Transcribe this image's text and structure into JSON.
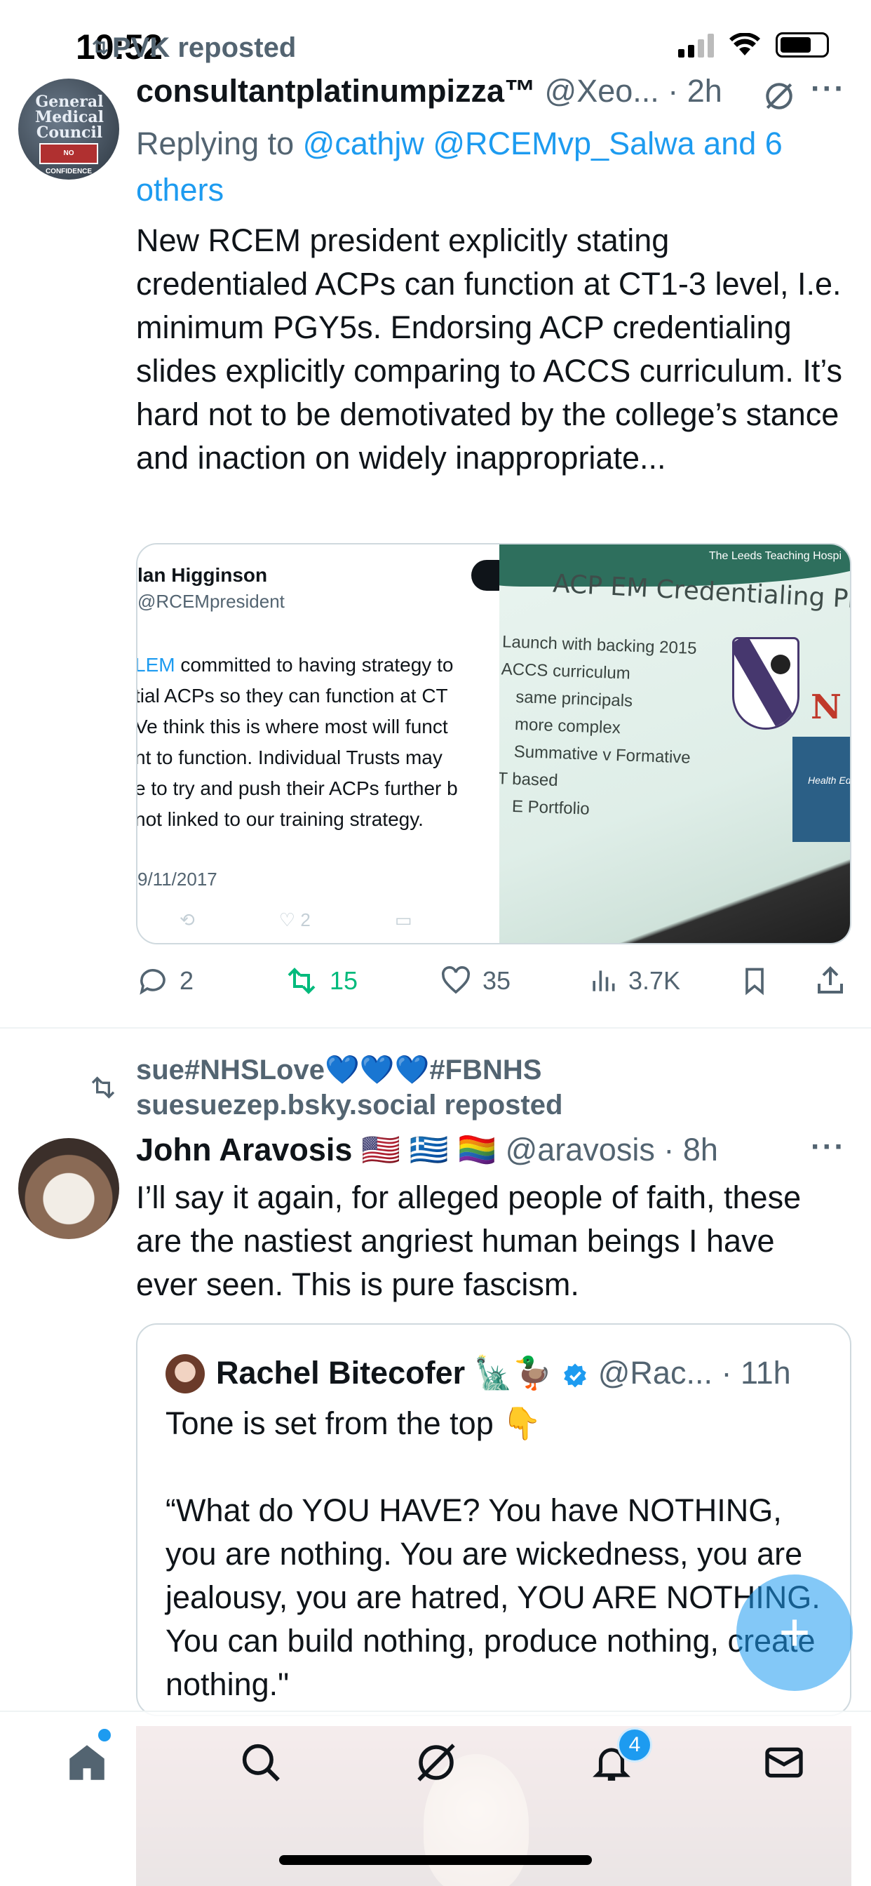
{
  "status_bar": {
    "time": "10:52"
  },
  "post1": {
    "repost_label": "PVK reposted",
    "name": "consultantplatinumpizza™",
    "handle_time": "@Xeo... · 2h",
    "reply_prefix": "Replying to ",
    "reply_mentions": "@cathjw @RCEMvp_Salwa and 6 others",
    "text": "New RCEM president explicitly stating credentialed ACPs can function at CT1-3 level, I.e. minimum PGY5s. Endorsing ACP credentialing slides explicitly comparing to ACCS curriculum. It’s hard not to be demotivated by the college’s stance and inaction on widely inappropriate...",
    "avatar_text": "General Medical Council",
    "avatar_badge": "NO CONFIDENCE",
    "embedded_tweet": {
      "name": "lan Higginson",
      "handle": "@RCEMpresident",
      "link": "LEM",
      "line1": " committed to having strategy to",
      "line2": "tial ACPs so they can function at CT",
      "line3": "Ve think this is where most will funct",
      "line4": "nt to function. Individual Trusts may",
      "line5": "e to try and push their ACPs further b",
      "line6": "not linked to our training strategy.",
      "date": "9/11/2017",
      "likes": "2"
    },
    "slide": {
      "hospital": "The Leeds Teaching Hospi",
      "title": "ACP EM Credentialing Pilot",
      "bullets": [
        "Launch with backing 2015",
        "ACCS curriculum",
        "same principals",
        "more complex",
        "Summative v Formative",
        "T based",
        "E Portfolio"
      ],
      "logo_letter": "N",
      "hee_text": "Health Ed"
    },
    "actions": {
      "replies": "2",
      "reposts": "15",
      "likes": "35",
      "views": "3.7K"
    }
  },
  "post2": {
    "repost_line1": "sue#NHSLove",
    "repost_hearts": "💙💙💙",
    "repost_line1b": "#FBNHS",
    "repost_line2": "suesuezep.bsky.social reposted",
    "name": "John Aravosis",
    "flags": "🇺🇸 🇬🇷 🏳️‍🌈",
    "handle_time": "@aravosis · 8h",
    "text": "I’ll say it again, for alleged people of faith, these are the nastiest angriest human beings I have ever seen. This is pure fascism.",
    "quote": {
      "name": "Rachel Bitecofer",
      "emojis": "🗽🦆",
      "handle_time": "@Rac... · 11h",
      "text": "Tone is set from the top 👇\n\n“What do YOU HAVE? You have NOTHING, you are nothing. You are wickedness, you are jealousy, you are hatred, YOU ARE NOTHING. You can build nothing, produce nothing, create nothing.\""
    }
  },
  "tab_bar": {
    "notifications_count": "4"
  },
  "colors": {
    "accent": "#1d9bf0",
    "repost_green": "#00ba7c",
    "muted": "#536471",
    "border": "#cfd9de"
  }
}
